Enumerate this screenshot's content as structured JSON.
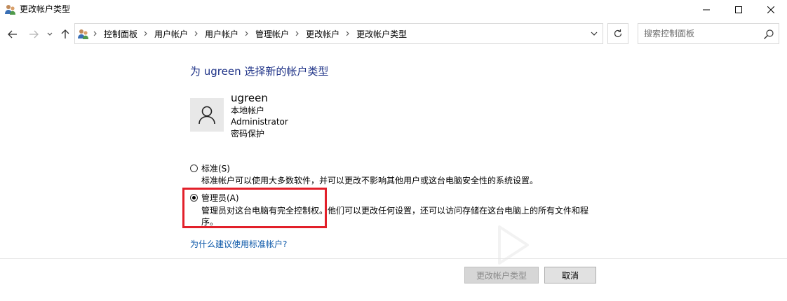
{
  "window": {
    "title": "更改帐户类型"
  },
  "navigation": {
    "breadcrumbs": [
      "控制面板",
      "用户帐户",
      "用户帐户",
      "管理帐户",
      "更改帐户",
      "更改帐户类型"
    ],
    "search_placeholder": "搜索控制面板"
  },
  "main": {
    "heading": "为 ugreen 选择新的帐户类型",
    "account": {
      "name": "ugreen",
      "details": [
        "本地帐户",
        "Administrator",
        "密码保护"
      ]
    },
    "options": [
      {
        "label": "标准(S)",
        "description": "标准帐户可以使用大多数软件，并可以更改不影响其他用户或这台电脑安全性的系统设置。",
        "selected": false
      },
      {
        "label": "管理员(A)",
        "description_line1": "管理员对这台电脑有完全控制权。他们可以更改任何设置，还可以访问存储在这台电脑上的所有文件和程",
        "description_line2": "序。",
        "selected": true
      }
    ],
    "link": "为什么建议使用标准帐户?"
  },
  "buttons": {
    "change": "更改帐户类型",
    "cancel": "取消"
  },
  "colors": {
    "heading": "#1e3287",
    "link": "#0b57a8",
    "highlight": "#e2202a"
  }
}
